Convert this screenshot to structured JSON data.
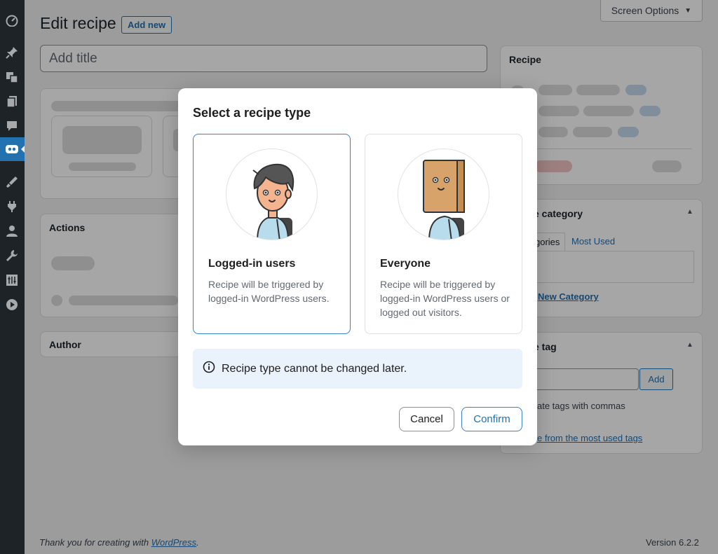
{
  "topbar": {
    "screen_options": "Screen Options",
    "screen_options_arrow": "▼"
  },
  "page": {
    "title": "Edit recipe",
    "add_new": "Add new",
    "title_placeholder": "Add title"
  },
  "panels": {
    "actions_title": "Actions",
    "author_title": "Author",
    "recipe_title": "Recipe",
    "category_title": "e category",
    "category_tab_all": "gories",
    "category_tab_most_used": "Most Used",
    "add_new_category": "New Category",
    "tag_title": "e tag",
    "tag_add_button": "Add",
    "tag_hint": "ate tags with commas",
    "tag_choose": "e from the most used tags",
    "toggle_arrow": "▲"
  },
  "footer": {
    "thanks_prefix": "Thank you for creating with ",
    "thanks_link": "WordPress",
    "thanks_suffix": ".",
    "version": "Version 6.2.2"
  },
  "modal": {
    "title": "Select a recipe type",
    "options": [
      {
        "title": "Logged-in users",
        "description": "Recipe will be triggered by logged-in WordPress users."
      },
      {
        "title": "Everyone",
        "description": "Recipe will be triggered by logged-in WordPress users or logged out visitors."
      }
    ],
    "notice": "Recipe type cannot be changed later.",
    "cancel": "Cancel",
    "confirm": "Confirm"
  },
  "colors": {
    "accent": "#2271b1",
    "sidebar": "#1d2327",
    "selected_border": "#3b82c4",
    "notice_bg": "#eaf2fb"
  }
}
